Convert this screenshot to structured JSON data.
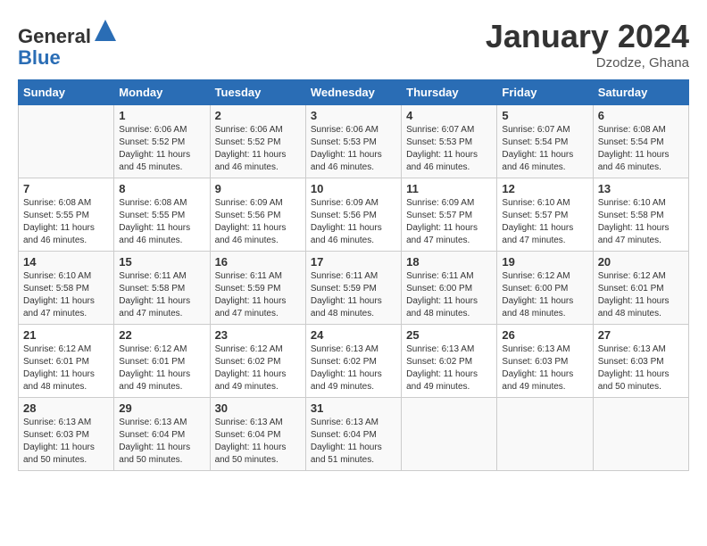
{
  "header": {
    "logo_line1": "General",
    "logo_line2": "Blue",
    "month": "January 2024",
    "location": "Dzodze, Ghana"
  },
  "columns": [
    "Sunday",
    "Monday",
    "Tuesday",
    "Wednesday",
    "Thursday",
    "Friday",
    "Saturday"
  ],
  "weeks": [
    [
      {
        "day": "",
        "sunrise": "",
        "sunset": "",
        "daylight": ""
      },
      {
        "day": "1",
        "sunrise": "Sunrise: 6:06 AM",
        "sunset": "Sunset: 5:52 PM",
        "daylight": "Daylight: 11 hours and 45 minutes."
      },
      {
        "day": "2",
        "sunrise": "Sunrise: 6:06 AM",
        "sunset": "Sunset: 5:52 PM",
        "daylight": "Daylight: 11 hours and 46 minutes."
      },
      {
        "day": "3",
        "sunrise": "Sunrise: 6:06 AM",
        "sunset": "Sunset: 5:53 PM",
        "daylight": "Daylight: 11 hours and 46 minutes."
      },
      {
        "day": "4",
        "sunrise": "Sunrise: 6:07 AM",
        "sunset": "Sunset: 5:53 PM",
        "daylight": "Daylight: 11 hours and 46 minutes."
      },
      {
        "day": "5",
        "sunrise": "Sunrise: 6:07 AM",
        "sunset": "Sunset: 5:54 PM",
        "daylight": "Daylight: 11 hours and 46 minutes."
      },
      {
        "day": "6",
        "sunrise": "Sunrise: 6:08 AM",
        "sunset": "Sunset: 5:54 PM",
        "daylight": "Daylight: 11 hours and 46 minutes."
      }
    ],
    [
      {
        "day": "7",
        "sunrise": "Sunrise: 6:08 AM",
        "sunset": "Sunset: 5:55 PM",
        "daylight": "Daylight: 11 hours and 46 minutes."
      },
      {
        "day": "8",
        "sunrise": "Sunrise: 6:08 AM",
        "sunset": "Sunset: 5:55 PM",
        "daylight": "Daylight: 11 hours and 46 minutes."
      },
      {
        "day": "9",
        "sunrise": "Sunrise: 6:09 AM",
        "sunset": "Sunset: 5:56 PM",
        "daylight": "Daylight: 11 hours and 46 minutes."
      },
      {
        "day": "10",
        "sunrise": "Sunrise: 6:09 AM",
        "sunset": "Sunset: 5:56 PM",
        "daylight": "Daylight: 11 hours and 46 minutes."
      },
      {
        "day": "11",
        "sunrise": "Sunrise: 6:09 AM",
        "sunset": "Sunset: 5:57 PM",
        "daylight": "Daylight: 11 hours and 47 minutes."
      },
      {
        "day": "12",
        "sunrise": "Sunrise: 6:10 AM",
        "sunset": "Sunset: 5:57 PM",
        "daylight": "Daylight: 11 hours and 47 minutes."
      },
      {
        "day": "13",
        "sunrise": "Sunrise: 6:10 AM",
        "sunset": "Sunset: 5:58 PM",
        "daylight": "Daylight: 11 hours and 47 minutes."
      }
    ],
    [
      {
        "day": "14",
        "sunrise": "Sunrise: 6:10 AM",
        "sunset": "Sunset: 5:58 PM",
        "daylight": "Daylight: 11 hours and 47 minutes."
      },
      {
        "day": "15",
        "sunrise": "Sunrise: 6:11 AM",
        "sunset": "Sunset: 5:58 PM",
        "daylight": "Daylight: 11 hours and 47 minutes."
      },
      {
        "day": "16",
        "sunrise": "Sunrise: 6:11 AM",
        "sunset": "Sunset: 5:59 PM",
        "daylight": "Daylight: 11 hours and 47 minutes."
      },
      {
        "day": "17",
        "sunrise": "Sunrise: 6:11 AM",
        "sunset": "Sunset: 5:59 PM",
        "daylight": "Daylight: 11 hours and 48 minutes."
      },
      {
        "day": "18",
        "sunrise": "Sunrise: 6:11 AM",
        "sunset": "Sunset: 6:00 PM",
        "daylight": "Daylight: 11 hours and 48 minutes."
      },
      {
        "day": "19",
        "sunrise": "Sunrise: 6:12 AM",
        "sunset": "Sunset: 6:00 PM",
        "daylight": "Daylight: 11 hours and 48 minutes."
      },
      {
        "day": "20",
        "sunrise": "Sunrise: 6:12 AM",
        "sunset": "Sunset: 6:01 PM",
        "daylight": "Daylight: 11 hours and 48 minutes."
      }
    ],
    [
      {
        "day": "21",
        "sunrise": "Sunrise: 6:12 AM",
        "sunset": "Sunset: 6:01 PM",
        "daylight": "Daylight: 11 hours and 48 minutes."
      },
      {
        "day": "22",
        "sunrise": "Sunrise: 6:12 AM",
        "sunset": "Sunset: 6:01 PM",
        "daylight": "Daylight: 11 hours and 49 minutes."
      },
      {
        "day": "23",
        "sunrise": "Sunrise: 6:12 AM",
        "sunset": "Sunset: 6:02 PM",
        "daylight": "Daylight: 11 hours and 49 minutes."
      },
      {
        "day": "24",
        "sunrise": "Sunrise: 6:13 AM",
        "sunset": "Sunset: 6:02 PM",
        "daylight": "Daylight: 11 hours and 49 minutes."
      },
      {
        "day": "25",
        "sunrise": "Sunrise: 6:13 AM",
        "sunset": "Sunset: 6:02 PM",
        "daylight": "Daylight: 11 hours and 49 minutes."
      },
      {
        "day": "26",
        "sunrise": "Sunrise: 6:13 AM",
        "sunset": "Sunset: 6:03 PM",
        "daylight": "Daylight: 11 hours and 49 minutes."
      },
      {
        "day": "27",
        "sunrise": "Sunrise: 6:13 AM",
        "sunset": "Sunset: 6:03 PM",
        "daylight": "Daylight: 11 hours and 50 minutes."
      }
    ],
    [
      {
        "day": "28",
        "sunrise": "Sunrise: 6:13 AM",
        "sunset": "Sunset: 6:03 PM",
        "daylight": "Daylight: 11 hours and 50 minutes."
      },
      {
        "day": "29",
        "sunrise": "Sunrise: 6:13 AM",
        "sunset": "Sunset: 6:04 PM",
        "daylight": "Daylight: 11 hours and 50 minutes."
      },
      {
        "day": "30",
        "sunrise": "Sunrise: 6:13 AM",
        "sunset": "Sunset: 6:04 PM",
        "daylight": "Daylight: 11 hours and 50 minutes."
      },
      {
        "day": "31",
        "sunrise": "Sunrise: 6:13 AM",
        "sunset": "Sunset: 6:04 PM",
        "daylight": "Daylight: 11 hours and 51 minutes."
      },
      {
        "day": "",
        "sunrise": "",
        "sunset": "",
        "daylight": ""
      },
      {
        "day": "",
        "sunrise": "",
        "sunset": "",
        "daylight": ""
      },
      {
        "day": "",
        "sunrise": "",
        "sunset": "",
        "daylight": ""
      }
    ]
  ]
}
